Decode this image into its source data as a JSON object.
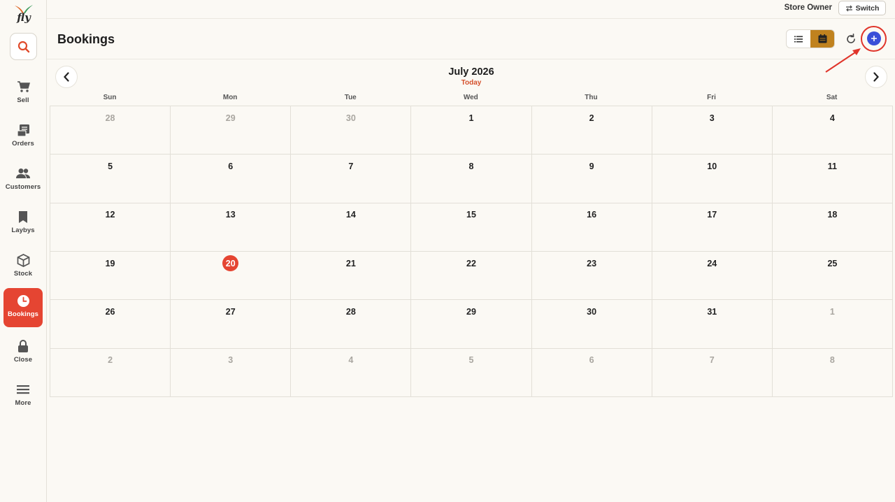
{
  "app": {
    "logo_text": "fly"
  },
  "topbar": {
    "owner": "Store Owner",
    "switch_label": "Switch"
  },
  "sidebar": {
    "items": [
      {
        "label": "Sell",
        "icon": "cart-icon"
      },
      {
        "label": "Orders",
        "icon": "orders-icon"
      },
      {
        "label": "Customers",
        "icon": "customers-icon"
      },
      {
        "label": "Laybys",
        "icon": "bookmark-icon"
      },
      {
        "label": "Stock",
        "icon": "box-icon"
      },
      {
        "label": "Bookings",
        "icon": "clock-icon",
        "active": true
      },
      {
        "label": "Close",
        "icon": "lock-icon"
      },
      {
        "label": "More",
        "icon": "menu-icon"
      }
    ]
  },
  "header": {
    "title": "Bookings"
  },
  "calendar": {
    "month": "July 2026",
    "today_label": "Today",
    "weekdays": [
      "Sun",
      "Mon",
      "Tue",
      "Wed",
      "Thu",
      "Fri",
      "Sat"
    ],
    "weeks": [
      [
        "28",
        "29",
        "30",
        "1",
        "2",
        "3",
        "4"
      ],
      [
        "5",
        "6",
        "7",
        "8",
        "9",
        "10",
        "11"
      ],
      [
        "12",
        "13",
        "14",
        "15",
        "16",
        "17",
        "18"
      ],
      [
        "19",
        "20",
        "21",
        "22",
        "23",
        "24",
        "25"
      ],
      [
        "26",
        "27",
        "28",
        "29",
        "30",
        "31",
        "1"
      ],
      [
        "2",
        "3",
        "4",
        "5",
        "6",
        "7",
        "8"
      ]
    ],
    "muted": [
      [
        0,
        0
      ],
      [
        0,
        1
      ],
      [
        0,
        2
      ],
      [
        4,
        6
      ],
      [
        5,
        0
      ],
      [
        5,
        1
      ],
      [
        5,
        2
      ],
      [
        5,
        3
      ],
      [
        5,
        4
      ],
      [
        5,
        5
      ],
      [
        5,
        6
      ]
    ],
    "today_day": "20",
    "accent": "#e54532"
  },
  "colors": {
    "accent": "#e54532",
    "toggle_active": "#c0821e",
    "add_button": "#3a4fd8",
    "today_text": "#d4502c"
  }
}
